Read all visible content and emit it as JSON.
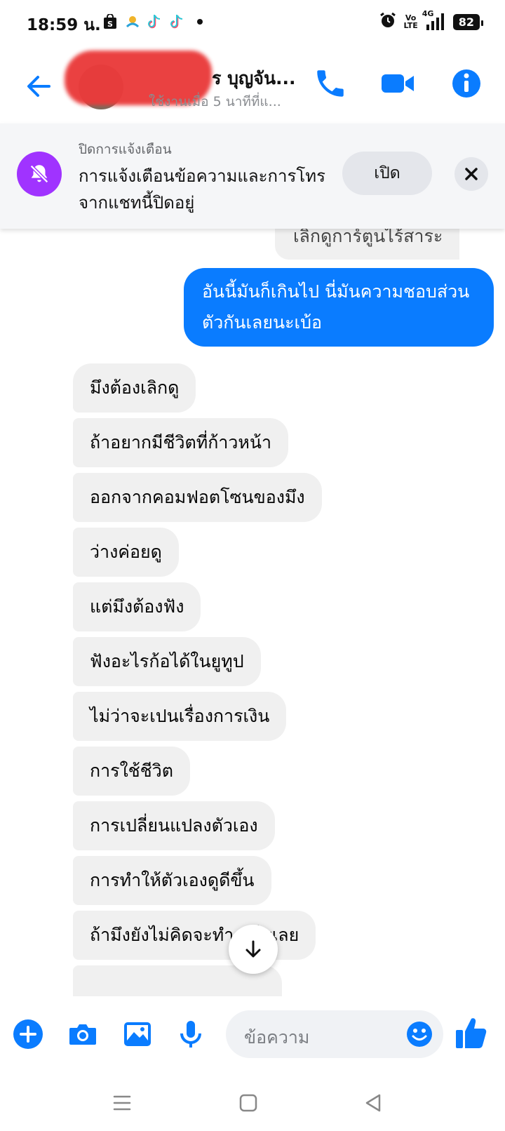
{
  "status_bar": {
    "time": "18:59 น.",
    "volte_line1": "Vo",
    "volte_line2": "LTE",
    "network": "4G",
    "battery": "82"
  },
  "header": {
    "contact_name": "ร บุญจัน...",
    "contact_status": "ใช้งานเมื่อ 5 นาทีที่แ...",
    "icons": [
      "back-arrow-icon",
      "phone-icon",
      "video-camera-icon",
      "info-icon"
    ],
    "accent_color": "#0a7cff"
  },
  "mute_banner": {
    "title": "ปิดการแจ้งเตือน",
    "message": "การแจ้งเตือนข้อความและการโทรจากแชทนี้ปิดอยู่",
    "open_button": "เปิด",
    "icon": "muted-bell-icon",
    "icon_color": "#a033ff"
  },
  "messages": {
    "previous_received": "เลิกดูการ์ตูนไร้สาระ",
    "sent": "อันนี้มันก็เกินไป นี่มันความชอบส่วนตัวกันเลยนะเบ้อ",
    "received": [
      "มึงต้องเลิกดู",
      "ถ้าอยากมีชีวิตที่ก้าวหน้า",
      "ออกจากคอมฟอตโซนของมึง",
      "ว่างค่อยดู",
      "แต่มึงต้องฟัง",
      "ฟังอะไรก้อได้ในยูทูป",
      "ไม่ว่าจะเปนเรื่องการเงิน",
      "การใช้ชีวิต",
      "การเปลี่ยนแปลงตัวเอง",
      "การทำให้ตัวเองดูดีขึ้น",
      "ถ้ามึงยังไม่คิดจะทำอะไรเลย"
    ]
  },
  "composer": {
    "placeholder": "ข้อความ",
    "icons": [
      "plus-icon",
      "camera-icon",
      "gallery-icon",
      "microphone-icon",
      "emoji-icon",
      "like-icon"
    ]
  },
  "nav_bar": {
    "icons": [
      "menu-icon",
      "home-icon",
      "back-icon"
    ]
  }
}
